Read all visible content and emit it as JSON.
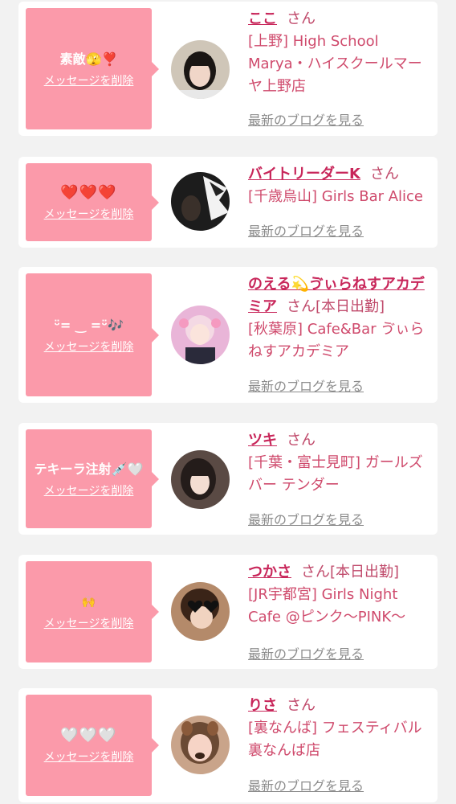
{
  "common": {
    "delete_label": "メッセージを削除",
    "blog_label": "最新のブログを見る",
    "san": "さん"
  },
  "colors": {
    "background": "#f2f2f2",
    "card": "#ffffff",
    "bubble": "#fb9aaa",
    "name": "#c8265a",
    "shop": "#cf4a6c",
    "blog_link": "#8c8c8c"
  },
  "entries": [
    {
      "message": "素敵🫣❣️",
      "name": "ここ",
      "status": "",
      "shop": "[上野] High School Marya・ハイスクールマーヤ上野店"
    },
    {
      "message": "❤️❤️❤️",
      "name": "バイトリーダーK",
      "status": "",
      "shop": "[千歳烏山] Girls Bar Alice"
    },
    {
      "message": "ᵕ̈= ‿ =ᵕ̈🎶",
      "name": "のえる💫ゔぃらねすアカデミア",
      "status": "[本日出勤]",
      "shop": "[秋葉原] Cafe&Bar ゔぃらねすアカデミア"
    },
    {
      "message": "テキーラ注射💉🤍",
      "name": "ツキ",
      "status": "",
      "shop": "[千葉・富士見町] ガールズバー テンダー"
    },
    {
      "message": "🙌",
      "name": "つかさ",
      "status": "[本日出勤]",
      "shop": "[JR宇都宮] Girls Night Cafe @ピンク～PINK～"
    },
    {
      "message": "🤍🤍🤍",
      "name": "りさ",
      "status": "",
      "shop": "[裏なんば] フェスティバル 裏なんば店"
    }
  ]
}
